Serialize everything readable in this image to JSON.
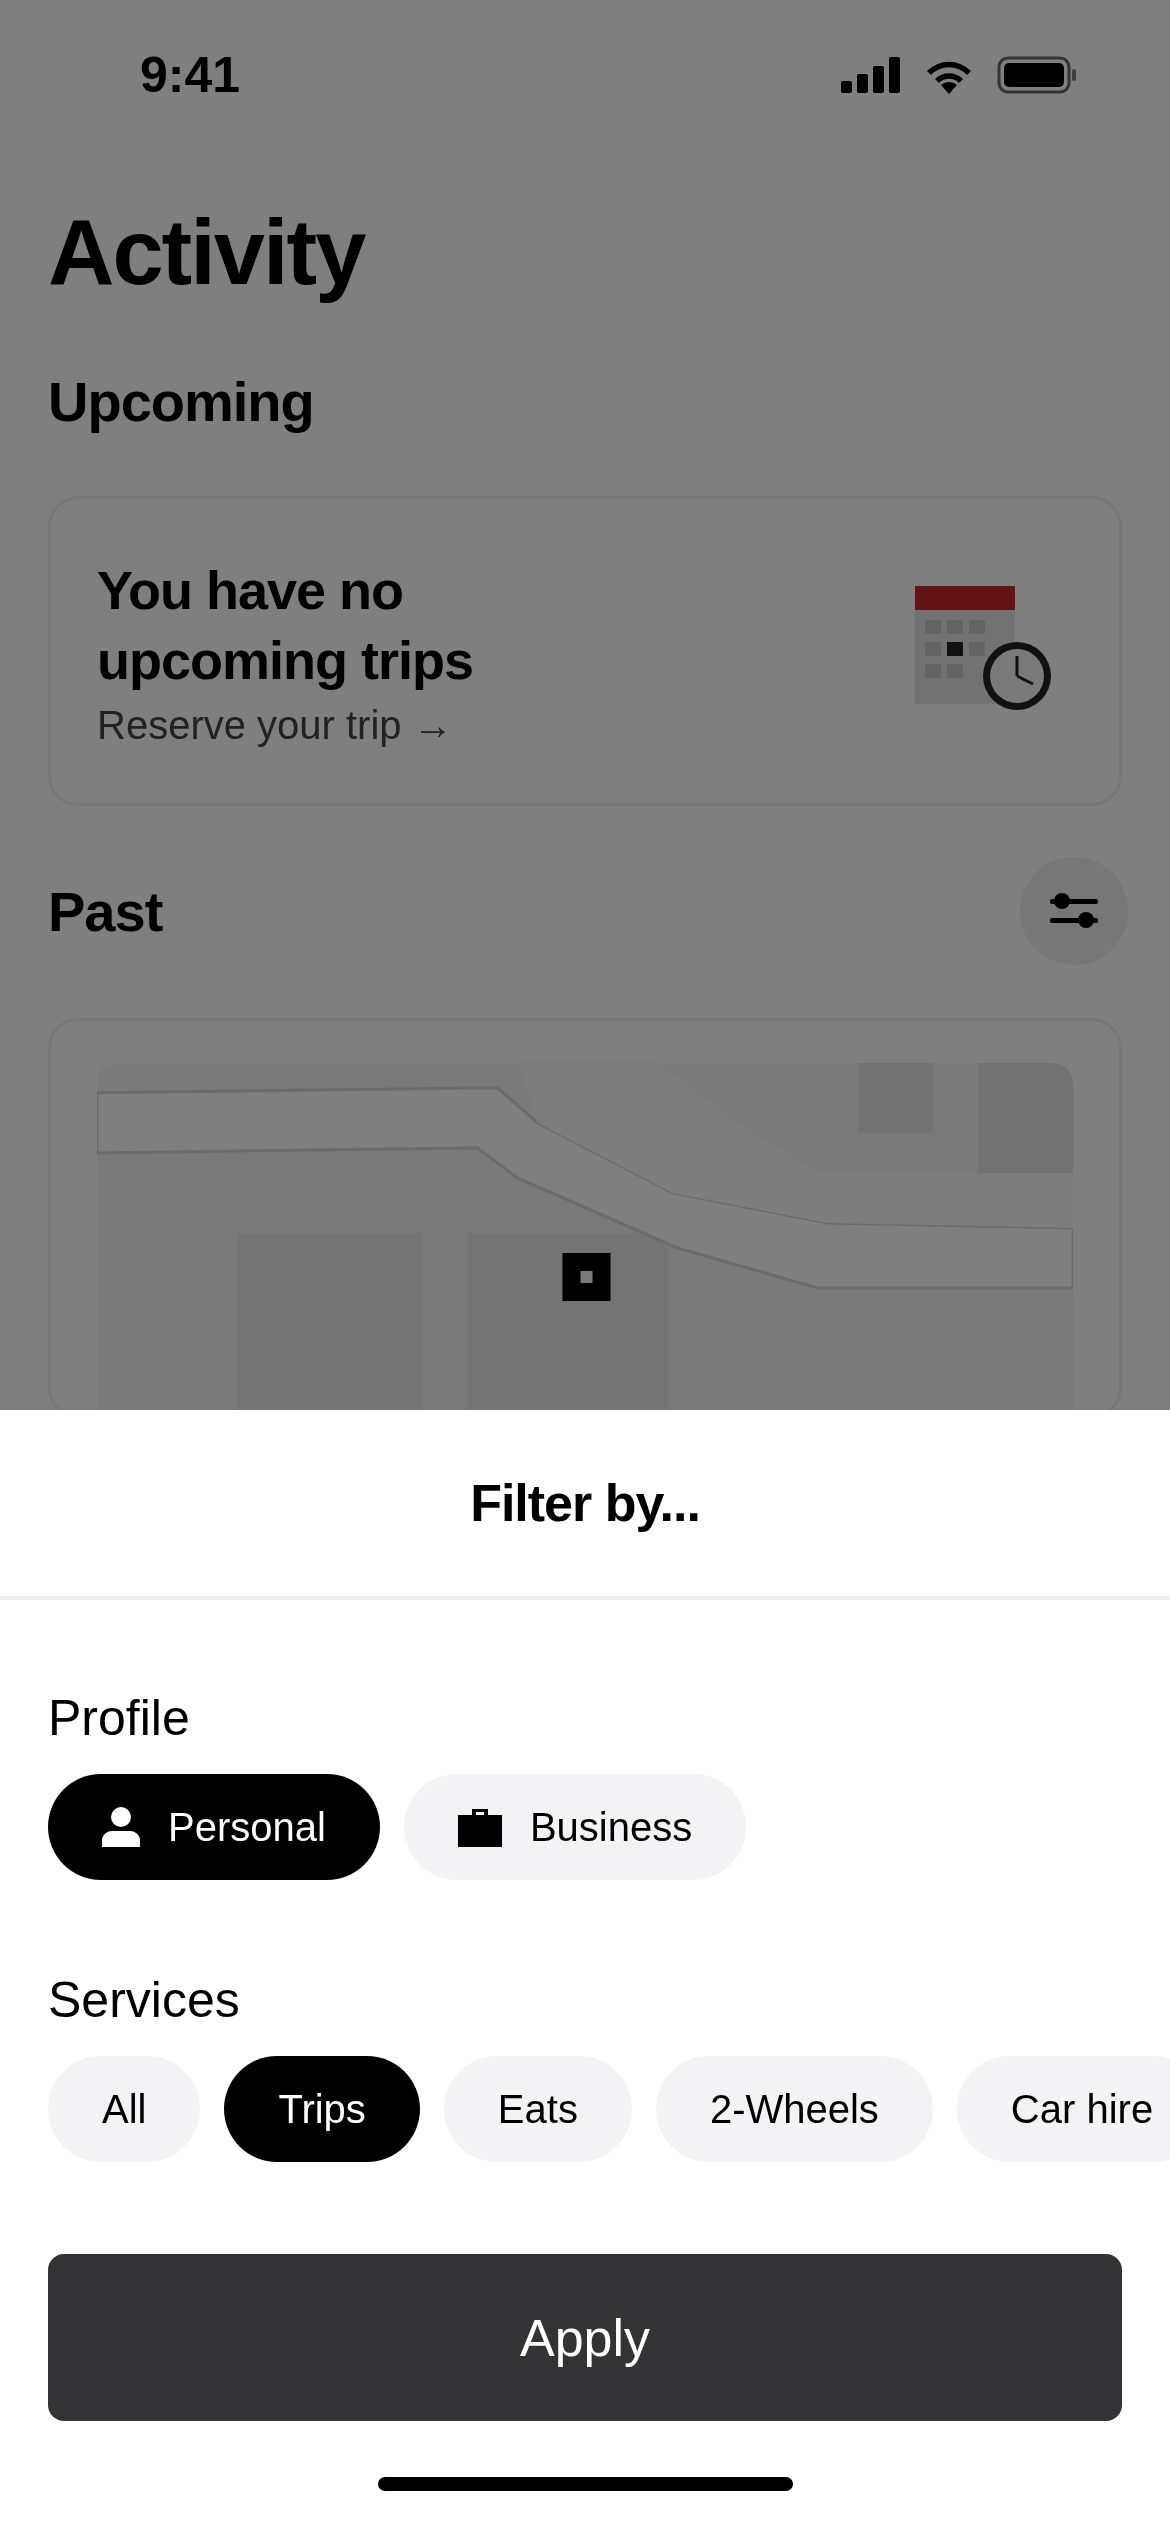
{
  "status_bar": {
    "time": "9:41"
  },
  "title": "Activity",
  "upcoming": {
    "heading": "Upcoming",
    "card": {
      "title": "You have no upcoming trips",
      "link": "Reserve your trip →"
    }
  },
  "past": {
    "heading": "Past"
  },
  "filter_sheet": {
    "title": "Filter by...",
    "sections": [
      {
        "heading": "Profile",
        "options": [
          {
            "label": "Personal",
            "kind": "person",
            "selected": true
          },
          {
            "label": "Business",
            "kind": "briefcase",
            "selected": false
          }
        ]
      },
      {
        "heading": "Services",
        "options": [
          {
            "label": "All",
            "selected": false
          },
          {
            "label": "Trips",
            "selected": true
          },
          {
            "label": "Eats",
            "selected": false
          },
          {
            "label": "2-Wheels",
            "selected": false
          },
          {
            "label": "Car hire",
            "selected": false
          }
        ]
      }
    ],
    "apply_button": "Apply"
  }
}
